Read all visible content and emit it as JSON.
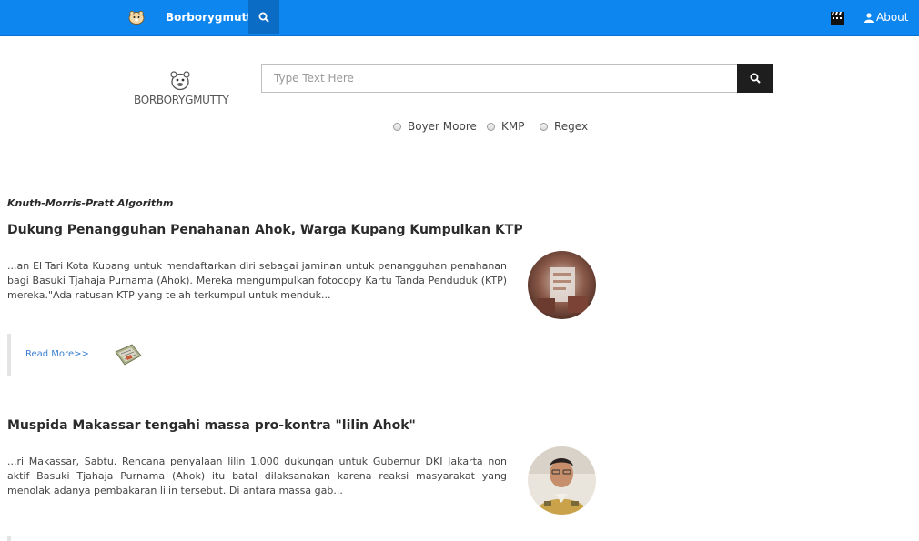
{
  "navbar": {
    "brand": "Borborygmutty",
    "about_label": "About",
    "icons": {
      "logo": "hamster-icon",
      "search": "search-icon",
      "film": "clapperboard-icon",
      "user": "user-icon"
    },
    "bg_color": "#0d86f0"
  },
  "search": {
    "logo_text": "BORBORYGMUTTY",
    "placeholder": "Type Text Here",
    "value": "",
    "options": [
      {
        "label": "Boyer Moore",
        "checked": false
      },
      {
        "label": "KMP",
        "checked": false
      },
      {
        "label": "Regex",
        "checked": false
      }
    ]
  },
  "results": {
    "algorithm_label": "Knuth-Morris-Pratt Algorithm",
    "articles": [
      {
        "title": "Dukung Penangguhan Penahanan Ahok, Warga Kupang Kumpulkan KTP",
        "excerpt": "...an El Tari Kota Kupang untuk mendaftarkan diri sebagai jaminan untuk penangguhan penahanan bagi Basuki Tjahaja Purnama (Ahok). Mereka mengumpulkan fotocopy Kartu Tanda Penduduk (KTP) mereka.\"Ada ratusan KTP yang telah terkumpul untuk menduk...",
        "read_more": "Read More>>"
      },
      {
        "title": "Muspida Makassar tengahi massa pro-kontra \"lilin Ahok\"",
        "excerpt": "...ri Makassar, Sabtu. Rencana penyalaan lilin 1.000 dukungan untuk Gubernur DKI Jakarta non aktif Basuki Tjahaja Purnama (Ahok) itu batal dilaksanakan karena reaksi masyarakat yang menolak adanya pembakaran lilin tersebut. Di antara massa gab..."
      }
    ]
  }
}
